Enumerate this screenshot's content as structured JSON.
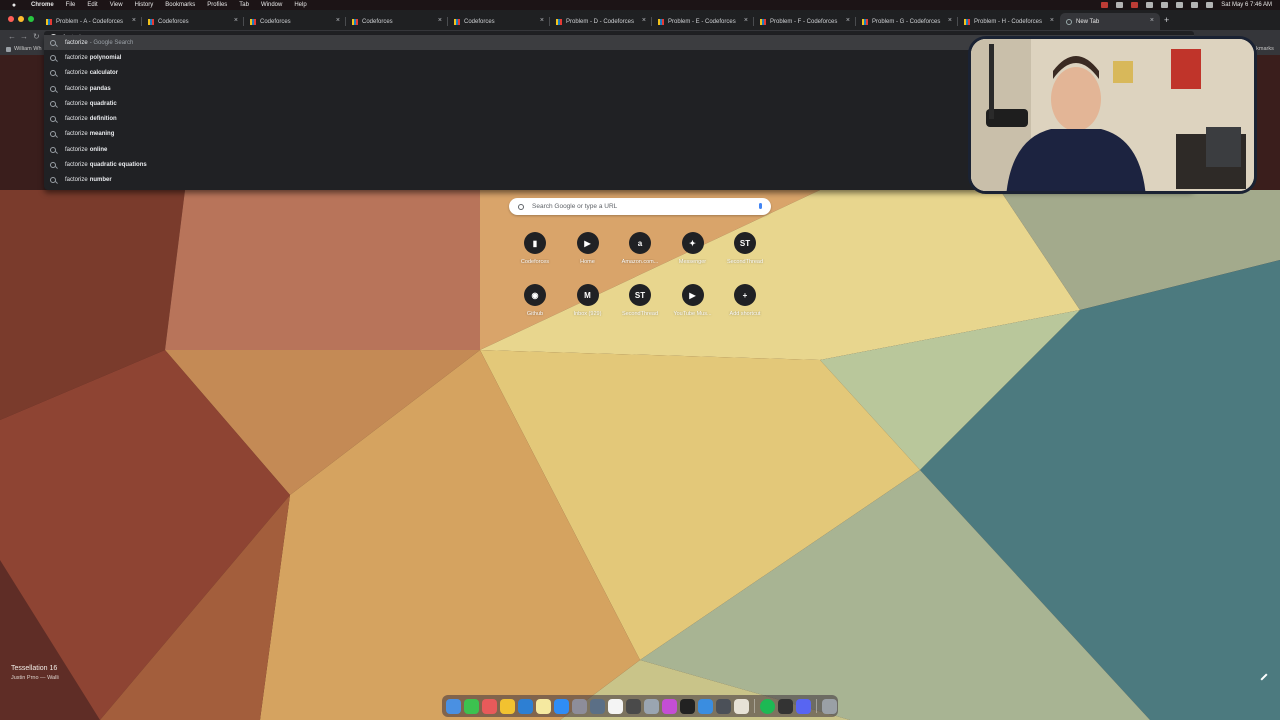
{
  "menubar": {
    "items": [
      "Chrome",
      "File",
      "Edit",
      "View",
      "History",
      "Bookmarks",
      "Profiles",
      "Tab",
      "Window",
      "Help"
    ],
    "datetime": "Sat May 6  7:46 AM"
  },
  "tabs": [
    {
      "title": "Problem - A - Codeforces",
      "icon": "codeforces-icon"
    },
    {
      "title": "Codeforces",
      "icon": "codeforces-icon"
    },
    {
      "title": "Codeforces",
      "icon": "codeforces-icon"
    },
    {
      "title": "Codeforces",
      "icon": "codeforces-icon"
    },
    {
      "title": "Codeforces",
      "icon": "codeforces-icon"
    },
    {
      "title": "Problem - D - Codeforces",
      "icon": "codeforces-icon"
    },
    {
      "title": "Problem - E - Codeforces",
      "icon": "codeforces-icon"
    },
    {
      "title": "Problem - F - Codeforces",
      "icon": "codeforces-icon"
    },
    {
      "title": "Problem - G - Codeforces",
      "icon": "codeforces-icon"
    },
    {
      "title": "Problem - H - Codeforces",
      "icon": "codeforces-icon"
    },
    {
      "title": "New Tab",
      "icon": "globe-icon",
      "active": true
    }
  ],
  "omnibox": {
    "value": "factorize "
  },
  "bookmarks": {
    "left": "William Wh",
    "right": "ookmarks"
  },
  "suggestions": [
    {
      "prefix": "factorize",
      "bold": "",
      "hint": "- Google Search",
      "selected": true
    },
    {
      "prefix": "factorize",
      "bold": "polynomial",
      "hint": ""
    },
    {
      "prefix": "factorize",
      "bold": "calculator",
      "hint": ""
    },
    {
      "prefix": "factorize",
      "bold": "pandas",
      "hint": ""
    },
    {
      "prefix": "factorize",
      "bold": "quadratic",
      "hint": ""
    },
    {
      "prefix": "factorize",
      "bold": "definition",
      "hint": ""
    },
    {
      "prefix": "factorize",
      "bold": "meaning",
      "hint": ""
    },
    {
      "prefix": "factorize",
      "bold": "online",
      "hint": ""
    },
    {
      "prefix": "factorize",
      "bold": "quadratic equations",
      "hint": ""
    },
    {
      "prefix": "factorize",
      "bold": "number",
      "hint": ""
    }
  ],
  "ntp": {
    "search_placeholder": "Search Google or type a URL",
    "shortcuts": [
      {
        "label": "Codeforces",
        "glyph": "▮",
        "color": "#202124"
      },
      {
        "label": "Home",
        "glyph": "▶",
        "color": "#202124"
      },
      {
        "label": "Amazon.com...",
        "glyph": "a",
        "color": "#202124"
      },
      {
        "label": "Messenger",
        "glyph": "✦",
        "color": "#202124"
      },
      {
        "label": "SecondThread",
        "glyph": "ST",
        "color": "#202124"
      },
      {
        "label": "Github",
        "glyph": "◉",
        "color": "#202124"
      },
      {
        "label": "Inbox (929)",
        "glyph": "M",
        "color": "#202124"
      },
      {
        "label": "SecondThread",
        "glyph": "ST",
        "color": "#202124"
      },
      {
        "label": "YouTube Mus...",
        "glyph": "▶",
        "color": "#202124"
      },
      {
        "label": "Add shortcut",
        "glyph": "+",
        "color": "#202124"
      }
    ]
  },
  "wallpaper": {
    "title": "Tessellation 16",
    "author": "Justin Prno — Walli"
  },
  "colors": {
    "chrome_dark": "#202124",
    "tab_active": "#35363a",
    "traffic_red": "#fe5f57",
    "traffic_yellow": "#febc2e",
    "traffic_green": "#28c840"
  }
}
